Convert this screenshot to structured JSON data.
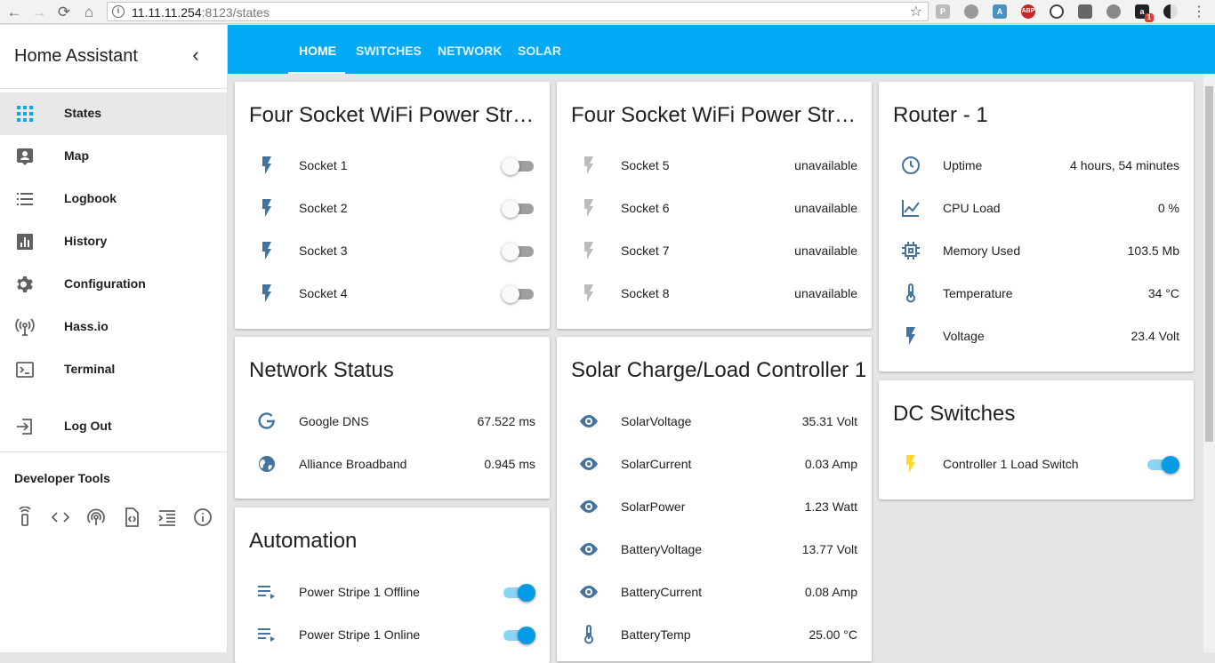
{
  "browser": {
    "url_host": "11.11.11.254",
    "url_rest": ":8123/states",
    "ext_badge": "1"
  },
  "sidebar": {
    "title": "Home Assistant",
    "items": [
      {
        "label": "States",
        "icon": "grid-icon"
      },
      {
        "label": "Map",
        "icon": "account-box-icon"
      },
      {
        "label": "Logbook",
        "icon": "list-icon"
      },
      {
        "label": "History",
        "icon": "chart-icon"
      },
      {
        "label": "Configuration",
        "icon": "gear-icon"
      },
      {
        "label": "Hass.io",
        "icon": "antenna-icon"
      },
      {
        "label": "Terminal",
        "icon": "console-icon"
      },
      {
        "label": "Log Out",
        "icon": "exit-icon"
      }
    ],
    "dev_tools_title": "Developer Tools"
  },
  "header": {
    "tabs": [
      "HOME",
      "SWITCHES",
      "NETWORK",
      "SOLAR"
    ]
  },
  "cards": {
    "strip1": {
      "title": "Four Socket WiFi Power Strip …",
      "rows": [
        {
          "name": "Socket 1",
          "state": "off"
        },
        {
          "name": "Socket 2",
          "state": "off"
        },
        {
          "name": "Socket 3",
          "state": "off"
        },
        {
          "name": "Socket 4",
          "state": "off"
        }
      ]
    },
    "strip2": {
      "title": "Four Socket WiFi Power Strip …",
      "rows": [
        {
          "name": "Socket 5",
          "value": "unavailable"
        },
        {
          "name": "Socket 6",
          "value": "unavailable"
        },
        {
          "name": "Socket 7",
          "value": "unavailable"
        },
        {
          "name": "Socket 8",
          "value": "unavailable"
        }
      ]
    },
    "router": {
      "title": "Router - 1",
      "rows": [
        {
          "name": "Uptime",
          "value": "4 hours, 54 minutes"
        },
        {
          "name": "CPU Load",
          "value": "0 %"
        },
        {
          "name": "Memory Used",
          "value": "103.5 Mb"
        },
        {
          "name": "Temperature",
          "value": "34 °C"
        },
        {
          "name": "Voltage",
          "value": "23.4 Volt"
        }
      ]
    },
    "network": {
      "title": "Network Status",
      "rows": [
        {
          "name": "Google DNS",
          "value": "67.522 ms"
        },
        {
          "name": "Alliance Broadband",
          "value": "0.945 ms"
        }
      ]
    },
    "solar": {
      "title": "Solar Charge/Load Controller 1",
      "rows": [
        {
          "name": "SolarVoltage",
          "value": "35.31 Volt"
        },
        {
          "name": "SolarCurrent",
          "value": "0.03 Amp"
        },
        {
          "name": "SolarPower",
          "value": "1.23 Watt"
        },
        {
          "name": "BatteryVoltage",
          "value": "13.77 Volt"
        },
        {
          "name": "BatteryCurrent",
          "value": "0.08 Amp"
        },
        {
          "name": "BatteryTemp",
          "value": "25.00 °C"
        }
      ]
    },
    "dc": {
      "title": "DC Switches",
      "rows": [
        {
          "name": "Controller 1 Load Switch",
          "state": "on"
        }
      ]
    },
    "automation": {
      "title": "Automation",
      "rows": [
        {
          "name": "Power Stripe 1 Offline",
          "state": "on"
        },
        {
          "name": "Power Stripe 1 Online",
          "state": "on"
        }
      ]
    }
  },
  "colors": {
    "accent": "#03a9f4",
    "icon": "#44739e",
    "bolt_on": "#fdd835",
    "bolt_off": "#9e9e9e"
  }
}
